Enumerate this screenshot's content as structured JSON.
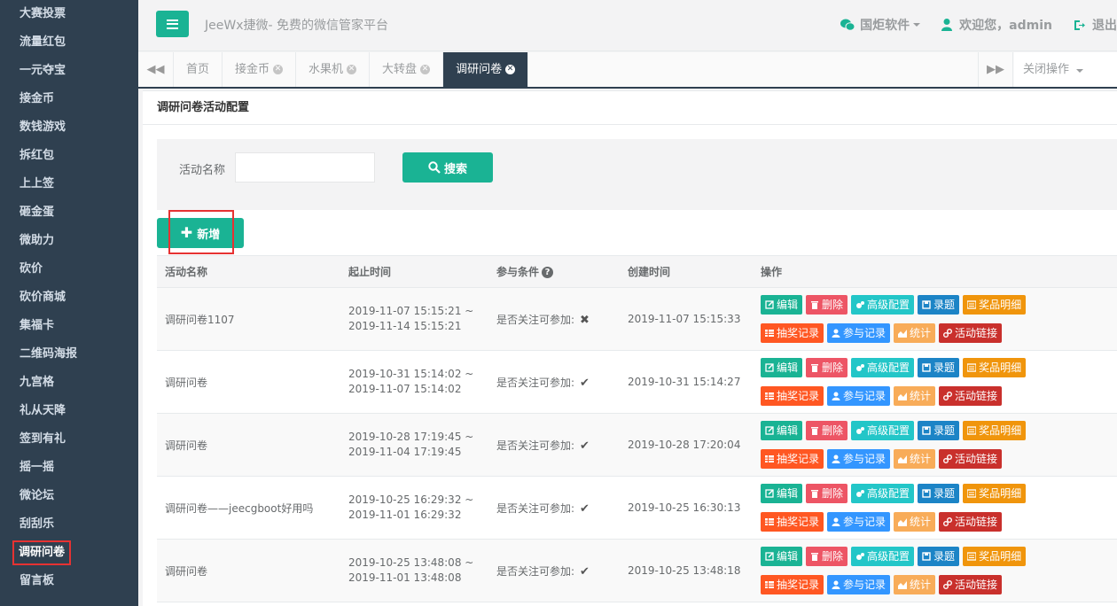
{
  "sidebar": {
    "items": [
      {
        "label": "大赛投票"
      },
      {
        "label": "流量红包"
      },
      {
        "label": "一元夺宝"
      },
      {
        "label": "接金币"
      },
      {
        "label": "数钱游戏"
      },
      {
        "label": "拆红包"
      },
      {
        "label": "上上签"
      },
      {
        "label": "砸金蛋"
      },
      {
        "label": "微助力"
      },
      {
        "label": "砍价"
      },
      {
        "label": "砍价商城"
      },
      {
        "label": "集福卡"
      },
      {
        "label": "二维码海报"
      },
      {
        "label": "九宫格"
      },
      {
        "label": "礼从天降"
      },
      {
        "label": "签到有礼"
      },
      {
        "label": "摇一摇"
      },
      {
        "label": "微论坛"
      },
      {
        "label": "刮刮乐"
      },
      {
        "label": "调研问卷"
      },
      {
        "label": "留言板"
      }
    ],
    "active_label": "调研问卷"
  },
  "header": {
    "title": "JeeWx捷微- 免费的微信管家平台",
    "company_label": "国炬软件",
    "welcome_label": "欢迎您，admin",
    "logout_label": "退出"
  },
  "tabs": {
    "items": [
      {
        "label": "首页",
        "closable": false,
        "active": false
      },
      {
        "label": "接金币",
        "closable": true,
        "active": false
      },
      {
        "label": "水果机",
        "closable": true,
        "active": false
      },
      {
        "label": "大转盘",
        "closable": true,
        "active": false
      },
      {
        "label": "调研问卷",
        "closable": true,
        "active": true
      }
    ],
    "close_ops_label": "关闭操作"
  },
  "main": {
    "panel_title": "调研问卷活动配置",
    "search": {
      "label": "活动名称",
      "value": "",
      "button_label": "搜索"
    },
    "add_button_label": "新增",
    "table": {
      "headers": {
        "name": "活动名称",
        "period": "起止时间",
        "condition": "参与条件",
        "created": "创建时间",
        "ops": "操作"
      },
      "condition_prefix": "是否关注可参加:",
      "rows": [
        {
          "name": "调研问卷1107",
          "start": "2019-11-07 15:15:21 ~",
          "end": "2019-11-14 15:15:21",
          "follow_required": "✖",
          "created": "2019-11-07 15:15:33"
        },
        {
          "name": "调研问卷",
          "start": "2019-10-31 15:14:02 ~",
          "end": "2019-11-07 15:14:02",
          "follow_required": "✔",
          "created": "2019-10-31 15:14:27"
        },
        {
          "name": "调研问卷",
          "start": "2019-10-28 17:19:45 ~",
          "end": "2019-11-04 17:19:45",
          "follow_required": "✔",
          "created": "2019-10-28 17:20:04"
        },
        {
          "name": "调研问卷——jeecgboot好用吗",
          "start": "2019-10-25 16:29:32 ~",
          "end": "2019-11-01 16:29:32",
          "follow_required": "✔",
          "created": "2019-10-25 16:30:13"
        },
        {
          "name": "调研问卷",
          "start": "2019-10-25 13:48:08 ~",
          "end": "2019-11-01 13:48:08",
          "follow_required": "✔",
          "created": "2019-10-25 13:48:18"
        }
      ],
      "op_labels": {
        "edit": "编辑",
        "delete": "删除",
        "advanced": "高级配置",
        "questions": "录题",
        "prize": "奖品明细",
        "lottery": "抽奖记录",
        "participants": "参与记录",
        "stats": "统计",
        "link": "活动链接"
      }
    }
  },
  "colors": {
    "sidebar_bg": "#2f4050",
    "primary": "#1ab394",
    "highlight": "#e63232"
  }
}
